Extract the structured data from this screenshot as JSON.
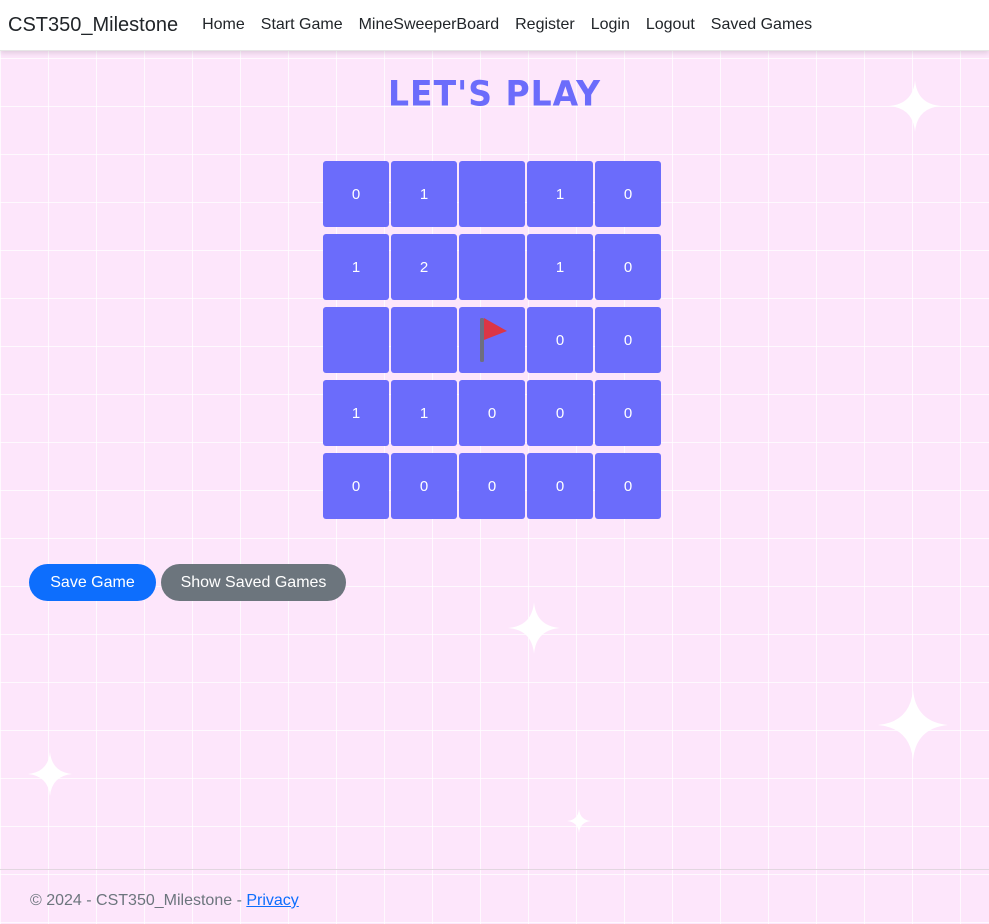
{
  "nav": {
    "brand": "CST350_Milestone",
    "links": [
      "Home",
      "Start Game",
      "MineSweeperBoard",
      "Register",
      "Login",
      "Logout",
      "Saved Games"
    ]
  },
  "page": {
    "title": "Let's Play"
  },
  "board": {
    "cells": [
      [
        "0",
        "1",
        "",
        "1",
        "0"
      ],
      [
        "1",
        "2",
        "",
        "1",
        "0"
      ],
      [
        "",
        "",
        "flag",
        "0",
        "0"
      ],
      [
        "1",
        "1",
        "0",
        "0",
        "0"
      ],
      [
        "0",
        "0",
        "0",
        "0",
        "0"
      ]
    ]
  },
  "actions": {
    "save_label": "Save Game",
    "show_saved_label": "Show Saved Games"
  },
  "footer": {
    "text": "© 2024 - CST350_Milestone - ",
    "privacy": "Privacy"
  },
  "colors": {
    "accent": "#6b6cfb",
    "background": "#fde6fb",
    "primary": "#0d6efd",
    "secondary": "#6c757d",
    "flag": "#dc3545"
  },
  "icons": {
    "flag": "flag-icon",
    "sparkle": "sparkle-icon"
  }
}
